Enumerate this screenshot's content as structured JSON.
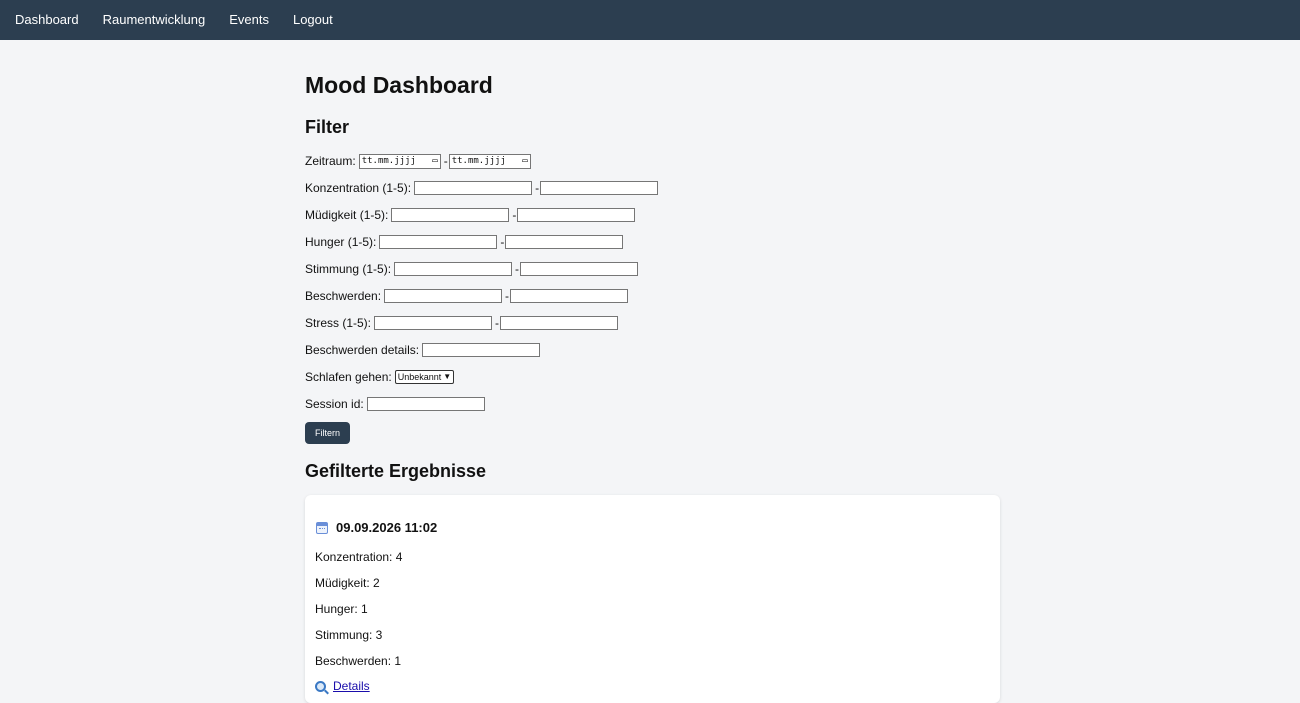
{
  "nav": {
    "items": [
      {
        "label": "Dashboard"
      },
      {
        "label": "Raumentwicklung"
      },
      {
        "label": "Events"
      },
      {
        "label": "Logout"
      }
    ]
  },
  "page": {
    "title": "Mood Dashboard",
    "filter_heading": "Filter",
    "results_heading": "Gefilterte Ergebnisse"
  },
  "filter": {
    "zeitraum": {
      "label": "Zeitraum:",
      "sep": "-",
      "from_placeholder": "tt.mm.jjjj",
      "to_placeholder": "tt.mm.jjjj"
    },
    "konzentration": {
      "label": "Konzentration (1-5):",
      "sep": "-"
    },
    "muedigkeit": {
      "label": "Müdigkeit (1-5):",
      "sep": "-"
    },
    "hunger": {
      "label": "Hunger (1-5):",
      "sep": "-"
    },
    "stimmung": {
      "label": "Stimmung (1-5):",
      "sep": "-"
    },
    "beschwerden": {
      "label": "Beschwerden:",
      "sep": "-"
    },
    "stress": {
      "label": "Stress (1-5):",
      "sep": "-"
    },
    "beschwerden_details": {
      "label": "Beschwerden details:"
    },
    "schlafen_gehen": {
      "label": "Schlafen gehen:",
      "selected": "Unbekannt"
    },
    "session_id": {
      "label": "Session id:"
    },
    "submit_label": "Filtern"
  },
  "results": [
    {
      "title": "09.09.2026 11:02",
      "konzentration": "Konzentration: 4",
      "muedigkeit": "Müdigkeit: 2",
      "hunger": "Hunger: 1",
      "stimmung": "Stimmung: 3",
      "beschwerden": "Beschwerden: 1",
      "details_label": "Details"
    }
  ],
  "icons": {
    "calendar": "calendar-icon",
    "details": "magnifier-icon"
  },
  "colors": {
    "nav_bg": "#2c3e50",
    "page_bg": "#f4f5f7",
    "button_bg": "#2c3e50",
    "link": "#1a0dab"
  }
}
